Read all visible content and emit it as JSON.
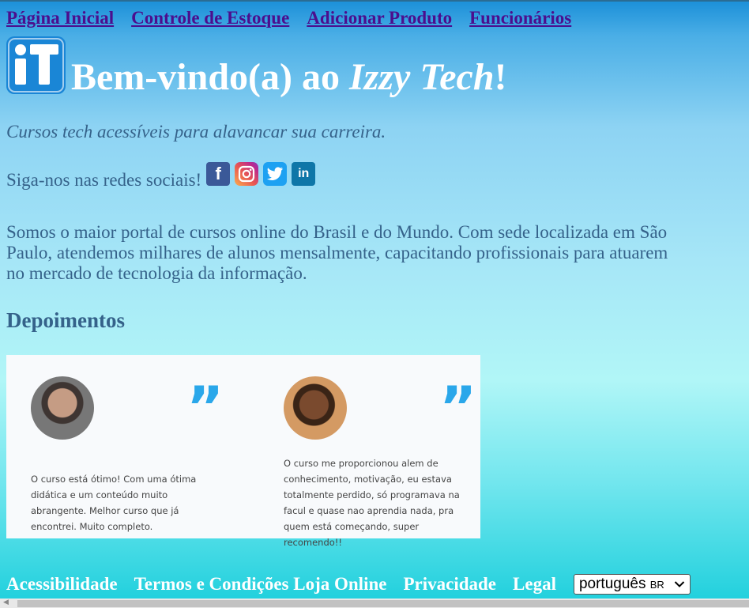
{
  "nav": {
    "links": [
      "Página Inicial",
      "Controle de Estoque",
      "Adicionar Produto",
      "Funcionários"
    ]
  },
  "brand": {
    "logo_text": "iT",
    "title_prefix": "Bem-vindo(a) ao ",
    "title_name": "Izzy Tech",
    "title_suffix": "!"
  },
  "tagline": "Cursos tech acessíveis para alavancar sua carreira.",
  "social": {
    "label": "Siga-nos nas redes sociais!",
    "icons": [
      "facebook-icon",
      "instagram-icon",
      "twitter-icon",
      "linkedin-icon"
    ]
  },
  "about": "Somos o maior portal de cursos online do Brasil e do Mundo. Com sede localizada em São Paulo, atendemos milhares de alunos mensalmente, capacitando profissionais para atuarem no mercado de tecnologia da informação.",
  "testimonials": {
    "title": "Depoimentos",
    "items": [
      {
        "quote_mark": "”",
        "text": "O curso está ótimo! Com uma ótima didática e um conteúdo muito abrangente. Melhor curso que já encontrei. Muito completo."
      },
      {
        "quote_mark": "”",
        "text": "O curso me proporcionou alem de conhecimento, motivação, eu estava totalmente perdido, só programava na facul e quase nao aprendia nada, pra quem está começando, super recomendo!!"
      }
    ]
  },
  "footer": {
    "links": [
      "Acessibilidade",
      "Termos e Condições Loja Online",
      "Privacidade",
      "Legal"
    ],
    "language": {
      "selected": "português",
      "region": "BR"
    }
  },
  "colors": {
    "nav_link": "#4b0e8e",
    "body_text": "#35628a",
    "quote_accent": "#2aa7ea",
    "logo_blue": "#1a86d6"
  }
}
